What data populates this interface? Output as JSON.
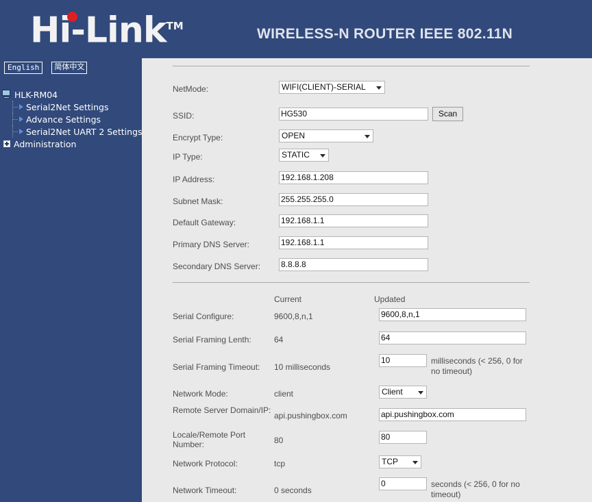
{
  "header": {
    "logo_text": "Hi-Link",
    "logo_tm": "TM",
    "title": "WIRELESS-N ROUTER IEEE 802.11N"
  },
  "sidebar": {
    "languages": [
      {
        "label": "English",
        "name": "lang-english"
      },
      {
        "label": "简体中文",
        "name": "lang-chinese"
      }
    ],
    "tree": {
      "root_label": "HLK-RM04",
      "root_icon": "computer-icon",
      "children": [
        {
          "label": "Serial2Net Settings",
          "icon": "arrow-right-icon"
        },
        {
          "label": "Advance Settings",
          "icon": "arrow-right-icon"
        },
        {
          "label": "Serial2Net UART 2 Settings",
          "icon": "arrow-right-icon"
        }
      ],
      "administration": {
        "label": "Administration",
        "icon": "plus-expander-icon"
      }
    }
  },
  "network": {
    "fields": {
      "netmode": {
        "label": "NetMode:",
        "value": "WIFI(CLIENT)-SERIAL"
      },
      "ssid": {
        "label": "SSID:",
        "value": "HG530",
        "scan_label": "Scan"
      },
      "encrypt_type": {
        "label": "Encrypt Type:",
        "value": "OPEN"
      },
      "ip_type": {
        "label": "IP Type:",
        "value": "STATIC"
      },
      "ip_address": {
        "label": "IP Address:",
        "value": "192.168.1.208"
      },
      "subnet_mask": {
        "label": "Subnet Mask:",
        "value": "255.255.255.0"
      },
      "default_gateway": {
        "label": "Default Gateway:",
        "value": "192.168.1.1"
      },
      "primary_dns": {
        "label": "Primary DNS Server:",
        "value": "192.168.1.1"
      },
      "secondary_dns": {
        "label": "Secondary DNS Server:",
        "value": "8.8.8.8"
      }
    }
  },
  "serial": {
    "columns": {
      "current": "Current",
      "updated": "Updated"
    },
    "rows": {
      "serial_configure": {
        "label": "Serial Configure:",
        "current": "9600,8,n,1",
        "updated": "9600,8,n,1"
      },
      "serial_framing_length": {
        "label": "Serial Framing Lenth:",
        "current": "64",
        "updated": "64"
      },
      "serial_framing_timeout": {
        "label": "Serial Framing Timeout:",
        "current": "10 milliseconds",
        "updated": "10",
        "hint": "milliseconds (< 256, 0 for no timeout)"
      },
      "network_mode": {
        "label": "Network Mode:",
        "current": "client",
        "updated": "Client"
      },
      "remote_server": {
        "label": "Remote Server Domain/IP:",
        "current": "api.pushingbox.com",
        "updated": "api.pushingbox.com"
      },
      "port_number": {
        "label": "Locale/Remote Port Number:",
        "current": "80",
        "updated": "80"
      },
      "network_protocol": {
        "label": "Network Protocol:",
        "current": "tcp",
        "updated": "TCP"
      },
      "network_timeout": {
        "label": "Network Timeout:",
        "current": "0 seconds",
        "updated": "0",
        "hint": "seconds (< 256, 0 for no timeout)"
      }
    }
  }
}
